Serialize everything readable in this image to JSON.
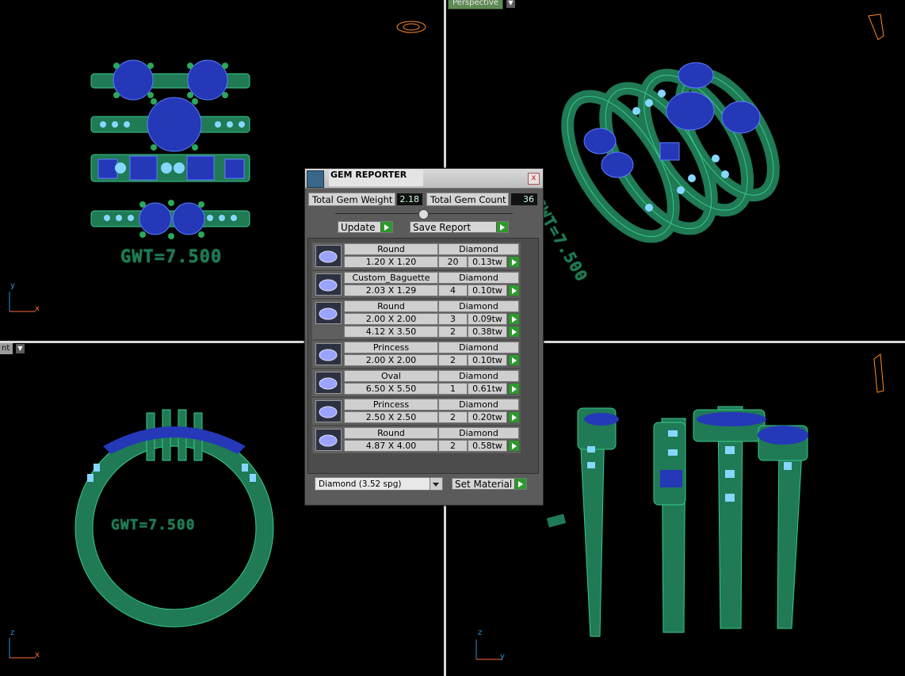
{
  "viewports": {
    "top_left": {
      "axis_x": "x",
      "axis_y": "y",
      "text": "GWT=7.500"
    },
    "top_right": {
      "label": "Perspective",
      "text": "GWT=7.500"
    },
    "bottom_left": {
      "label": "nt",
      "axis_x": "x",
      "axis_y": "z",
      "text": "GWT=7.500"
    },
    "bottom_right": {
      "axis_x": "y",
      "axis_y": "z"
    }
  },
  "panel": {
    "title": "GEM REPORTER",
    "close": "x",
    "total_weight_label": "Total Gem Weight",
    "total_weight_value": "2.18",
    "total_count_label": "Total Gem Count",
    "total_count_value": "36",
    "update_label": "Update",
    "save_label": "Save Report",
    "material_value": "Diamond    (3.52 spg)",
    "set_material_label": "Set Material",
    "gems": [
      {
        "shape": "Round",
        "material": "Diamond",
        "rows": [
          {
            "size": "1.20 X 1.20",
            "qty": "20",
            "tw": "0.13tw"
          }
        ]
      },
      {
        "shape": "Custom_Baguette",
        "material": "Diamond",
        "rows": [
          {
            "size": "2.03 X 1.29",
            "qty": "4",
            "tw": "0.10tw"
          }
        ]
      },
      {
        "shape": "Round",
        "material": "Diamond",
        "rows": [
          {
            "size": "2.00 X 2.00",
            "qty": "3",
            "tw": "0.09tw"
          },
          {
            "size": "4.12 X 3.50",
            "qty": "2",
            "tw": "0.38tw"
          }
        ]
      },
      {
        "shape": "Princess",
        "material": "Diamond",
        "rows": [
          {
            "size": "2.00 X 2.00",
            "qty": "2",
            "tw": "0.10tw"
          }
        ]
      },
      {
        "shape": "Oval",
        "material": "Diamond",
        "rows": [
          {
            "size": "6.50 X 5.50",
            "qty": "1",
            "tw": "0.61tw"
          }
        ]
      },
      {
        "shape": "Princess",
        "material": "Diamond",
        "rows": [
          {
            "size": "2.50 X 2.50",
            "qty": "2",
            "tw": "0.20tw"
          }
        ]
      },
      {
        "shape": "Round",
        "material": "Diamond",
        "rows": [
          {
            "size": "4.87 X 4.00",
            "qty": "2",
            "tw": "0.58tw"
          }
        ]
      }
    ]
  },
  "colors": {
    "metal": "#1f7a55",
    "gem": "#2438b8",
    "highlight": "#86d7ff"
  }
}
